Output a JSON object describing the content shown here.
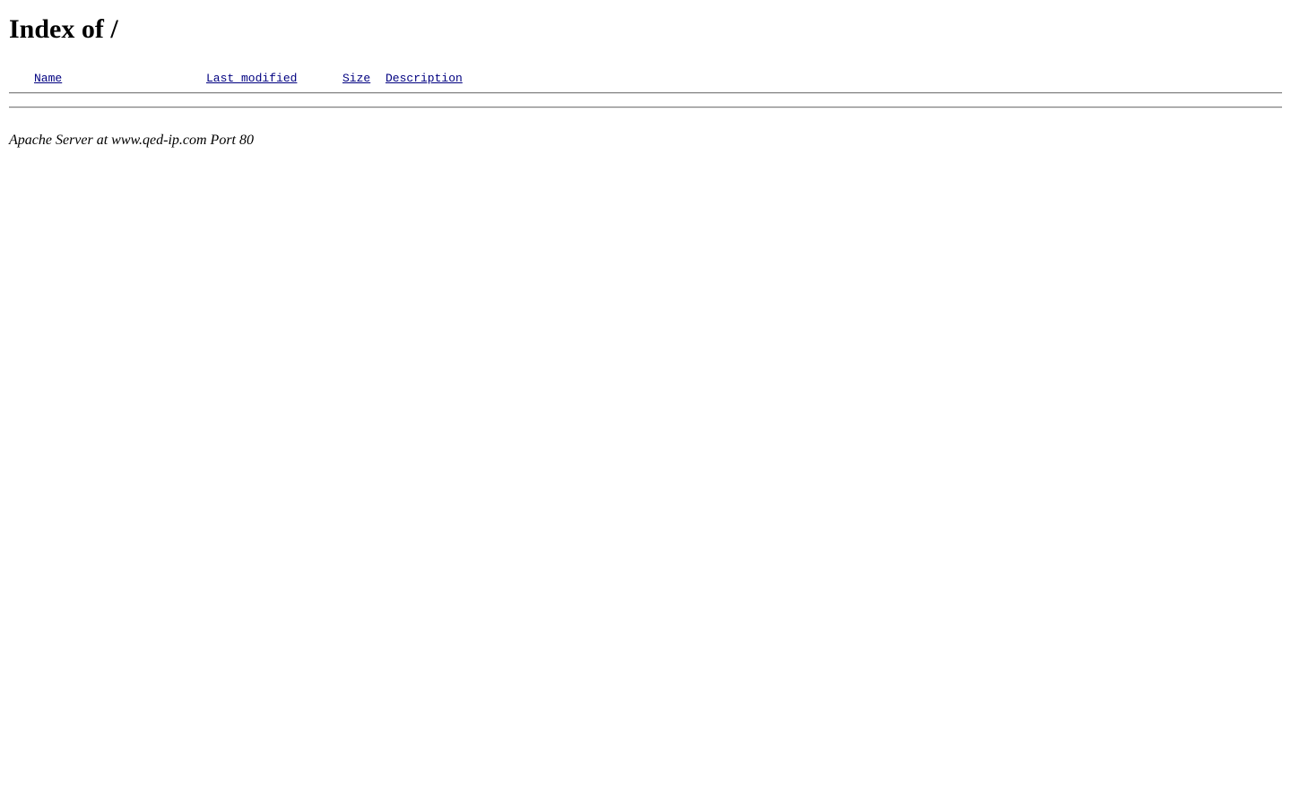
{
  "page": {
    "title": "Index of /"
  },
  "listing": {
    "columns": {
      "name": "Name",
      "last_modified": "Last modified",
      "size": "Size",
      "description": "Description"
    },
    "rows": []
  },
  "footer": {
    "signature": "Apache Server at www.qed-ip.com Port 80"
  },
  "colors": {
    "link": "#000080",
    "rule": "#808080"
  }
}
